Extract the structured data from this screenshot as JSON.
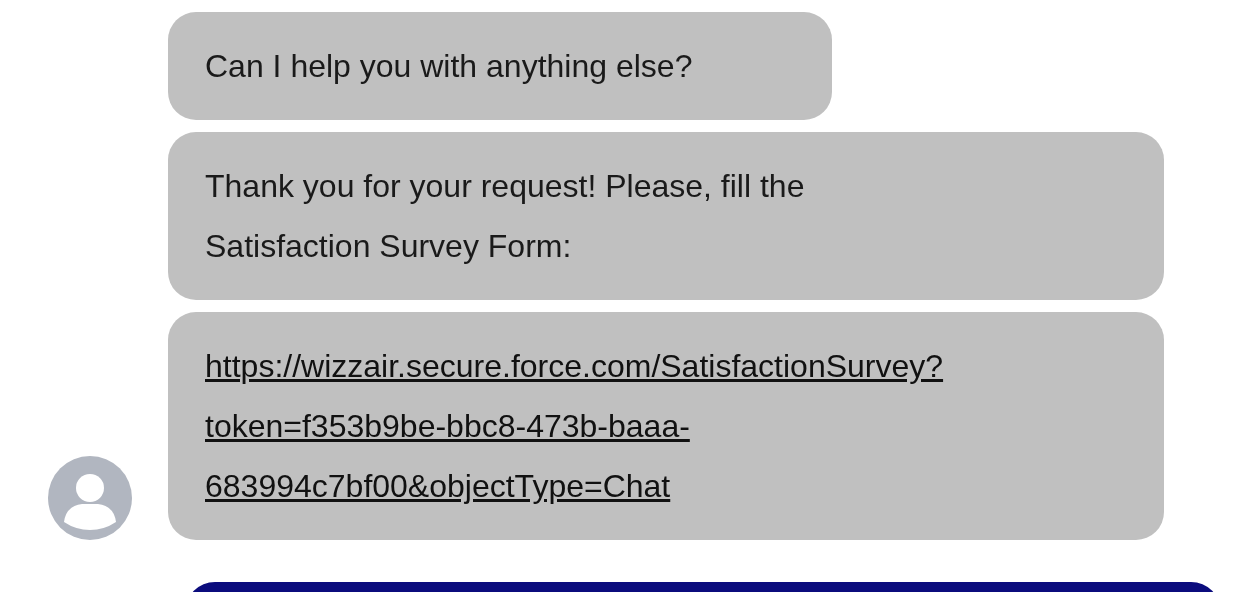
{
  "messages": [
    {
      "kind": "text",
      "text": "Can I help you with anything else?"
    },
    {
      "kind": "text",
      "text": "Thank you for your request! Please, fill the Satisfaction Survey Form:"
    },
    {
      "kind": "link",
      "text": "https://wizzair.secure.force.com/SatisfactionSurvey?token=f353b9be-bbc8-473b-baaa-683994c7bf00&objectType=Chat"
    }
  ]
}
